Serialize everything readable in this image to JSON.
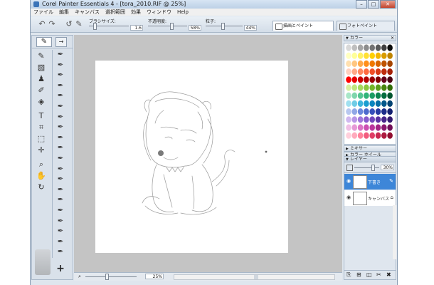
{
  "window": {
    "title": "Corel Painter Essentials 4 - [tora_2010.RIF @ 25%]",
    "min_label": "–",
    "max_label": "□",
    "close_label": "✕"
  },
  "menu": [
    "ファイル",
    "編集",
    "キャンバス",
    "選択範囲",
    "効果",
    "ウィンドウ",
    "Help"
  ],
  "property_bar": {
    "undo_glyph": "↶",
    "redo_glyph": "↷",
    "brush_size_label": "ブラシサイズ:",
    "brush_size_value": "1.6",
    "opacity_label": "不透明度:",
    "opacity_value": "58%",
    "grain_label": "粒子:",
    "grain_value": "44%"
  },
  "tabs": [
    {
      "label": "描画とペイント",
      "active": true
    },
    {
      "label": "フォトペイント",
      "active": false
    }
  ],
  "toolbox": {
    "current_glyph": "✎",
    "nav_glyph": "→",
    "tools": [
      {
        "name": "brush-tool-icon",
        "glyph": "✎"
      },
      {
        "name": "eraser-tool-icon",
        "glyph": "▧"
      },
      {
        "name": "stamp-tool-icon",
        "glyph": "♟"
      },
      {
        "name": "dropper-tool-icon",
        "glyph": "✐"
      },
      {
        "name": "bucket-tool-icon",
        "glyph": "◈"
      },
      {
        "name": "text-tool-icon",
        "glyph": "T"
      },
      {
        "name": "crop-tool-icon",
        "glyph": "⌗"
      },
      {
        "name": "marquee-tool-icon",
        "glyph": "⬚"
      },
      {
        "name": "transform-tool-icon",
        "glyph": "✛"
      },
      {
        "name": "magnifier-tool-icon",
        "glyph": "⌕"
      },
      {
        "name": "grabber-tool-icon",
        "glyph": "✋"
      },
      {
        "name": "rotate-tool-icon",
        "glyph": "↻"
      }
    ],
    "brush_variant_glyph": "✒",
    "brush_variant_count": 20,
    "add_glyph": "+"
  },
  "status": {
    "zoom_value": "25%",
    "zoom_icon": "⌕"
  },
  "panels": {
    "color_panel_title": "カラー",
    "mixer_title": "ミキサー",
    "color_wheel_title": "カラー ホイール",
    "layers_title": "レイヤー",
    "layer_opacity_value": "30%",
    "close_glyph": "✕"
  },
  "palette_colors": [
    [
      "#d9d9d9",
      "#bfbfbf",
      "#a6a6a6",
      "#8c8c8c",
      "#737373",
      "#595959",
      "#404040",
      "#0d0d0d"
    ],
    [
      "#ffffc0",
      "#ffff99",
      "#fff266",
      "#ffe033",
      "#ffd000",
      "#f2b600",
      "#d99c00",
      "#bf8500"
    ],
    [
      "#ffe0b0",
      "#ffc680",
      "#ffab4d",
      "#ff8f1a",
      "#f07800",
      "#d96500",
      "#bf5400",
      "#a64500"
    ],
    [
      "#ffd0c0",
      "#ffaa88",
      "#ff8860",
      "#ff6a40",
      "#f04f26",
      "#d93a14",
      "#bf2d0d",
      "#a62008"
    ],
    [
      "#ff0000",
      "#e60000",
      "#cc0000",
      "#b30000",
      "#990000",
      "#800000",
      "#66001a",
      "#4d0014"
    ],
    [
      "#d8f0a0",
      "#bfe680",
      "#a6d960",
      "#8cc83f",
      "#73b52a",
      "#5c9e1a",
      "#47860f",
      "#336e08"
    ],
    [
      "#a8e6c8",
      "#7fd6ad",
      "#56c692",
      "#30b478",
      "#1a9d63",
      "#0d8550",
      "#066d3f",
      "#035630"
    ],
    [
      "#a0e0f0",
      "#70cce6",
      "#40b5dc",
      "#1a9dd0",
      "#0a85bf",
      "#056ea6",
      "#03588c",
      "#024373"
    ],
    [
      "#b8c8f0",
      "#90a8e6",
      "#6b88dc",
      "#4d6acd",
      "#3650bb",
      "#273ca3",
      "#1c2d8a",
      "#132070"
    ],
    [
      "#d0b8f0",
      "#b897e6",
      "#a078dc",
      "#885ccd",
      "#7045bb",
      "#5a33a3",
      "#46258a",
      "#341a70"
    ],
    [
      "#f0c0e6",
      "#e69ad6",
      "#dc74c6",
      "#cd50b2",
      "#bb359c",
      "#a32585",
      "#8a186e",
      "#700f58"
    ],
    [
      "#ffd0dc",
      "#ffaabc",
      "#ff839c",
      "#f25c7e",
      "#e03d65",
      "#c82850",
      "#ad1a3f",
      "#920f31"
    ]
  ],
  "layers": [
    {
      "name": "下書き",
      "selected": true
    },
    {
      "name": "キャンバス",
      "selected": false
    }
  ],
  "layer_buttons": [
    "⎘",
    "⊞",
    "◫",
    "✂",
    "✖"
  ]
}
